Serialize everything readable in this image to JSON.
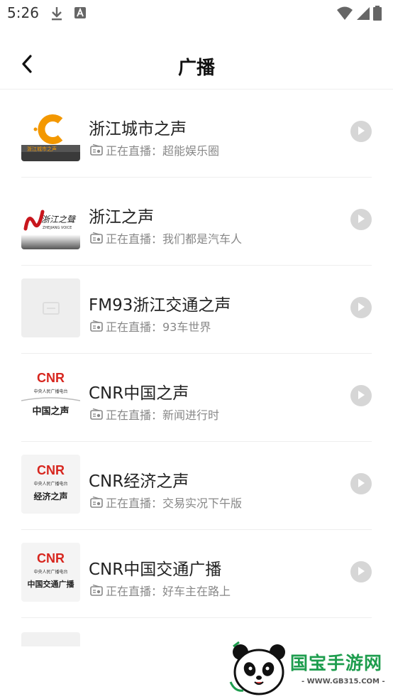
{
  "status_bar": {
    "time": "5:26"
  },
  "header": {
    "title": "广播"
  },
  "stations": [
    {
      "name": "浙江城市之声",
      "now_playing": "正在直播：超能娱乐圈",
      "logo": "city-voice-logo"
    },
    {
      "name": "浙江之声",
      "now_playing": "正在直播：我们都是汽车人",
      "logo": "zhejiang-voice-logo"
    },
    {
      "name": "FM93浙江交通之声",
      "now_playing": "正在直播：93车世界",
      "logo": "placeholder-image"
    },
    {
      "name": "CNR中国之声",
      "now_playing": "正在直播：新闻进行时",
      "logo": "cnr-logo",
      "logo_caption": "中国之声",
      "logo_sub": "中央人民广播电台"
    },
    {
      "name": "CNR经济之声",
      "now_playing": "正在直播：交易实况下午版",
      "logo": "cnr-logo",
      "logo_caption": "经济之声",
      "logo_sub": "中央人民广播电台"
    },
    {
      "name": "CNR中国交通广播",
      "now_playing": "正在直播：好车主在路上",
      "logo": "cnr-logo",
      "logo_caption": "中国交通广播",
      "logo_sub": "中央人民广播电台"
    }
  ],
  "logos": {
    "city_caption": "浙江城市之声",
    "cnr_mark": "CNR",
    "zhejiang_script": "浙江之聲",
    "zhejiang_sub": "ZHEJIANG VOICE"
  },
  "watermark": {
    "brand": "国宝手游网",
    "url": "- WWW.GB315.COM -"
  },
  "colors": {
    "accent_green": "#1e9d4e",
    "cnr_red": "#d7261e",
    "city_orange": "#f39800",
    "play_grey": "#d6d6d6"
  }
}
